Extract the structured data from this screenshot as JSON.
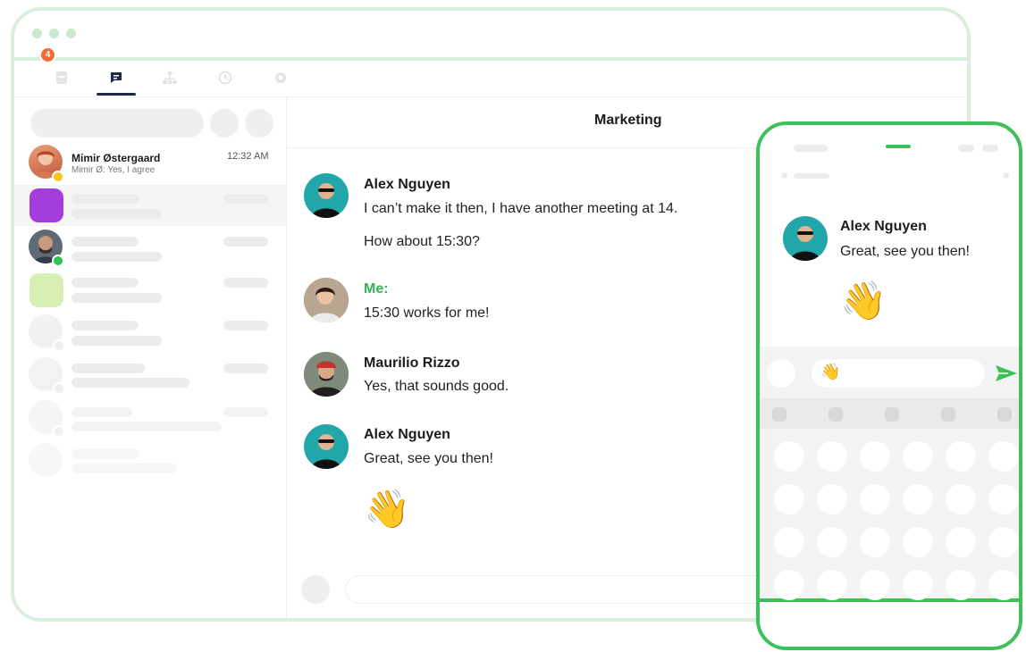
{
  "desktop": {
    "toolbar": {
      "icons": [
        "archive-icon",
        "chat-icon",
        "org-chart-icon",
        "history-icon",
        "settings-icon"
      ],
      "active_index": 1
    },
    "sidebar": {
      "first_contact": {
        "name": "Mimir Østergaard",
        "preview": "Mimir Ø: Yes, I agree",
        "time": "12:32 AM",
        "badge": "4"
      }
    },
    "chat": {
      "title": "Marketing",
      "messages": [
        {
          "author": "Alex Nguyen",
          "lines": [
            "I can’t make it then, I have another meeting at 14.",
            "How about 15:30?"
          ]
        },
        {
          "author": "Me:",
          "lines": [
            "15:30 works for me!"
          ]
        },
        {
          "author": "Maurilio Rizzo",
          "lines": [
            "Yes, that sounds good."
          ]
        },
        {
          "author": "Alex Nguyen",
          "lines": [
            "Great, see you then!"
          ],
          "emoji": "👋"
        }
      ]
    }
  },
  "mobile": {
    "message": {
      "author": "Alex Nguyen",
      "text": "Great, see you then!",
      "emoji": "👋"
    },
    "compose": {
      "value": "👋",
      "send_icon": "send-icon"
    }
  },
  "colors": {
    "accent": "#3cc159",
    "frame": "#d9efdc",
    "me": "#2fb553",
    "badge": "#f36b3b"
  }
}
